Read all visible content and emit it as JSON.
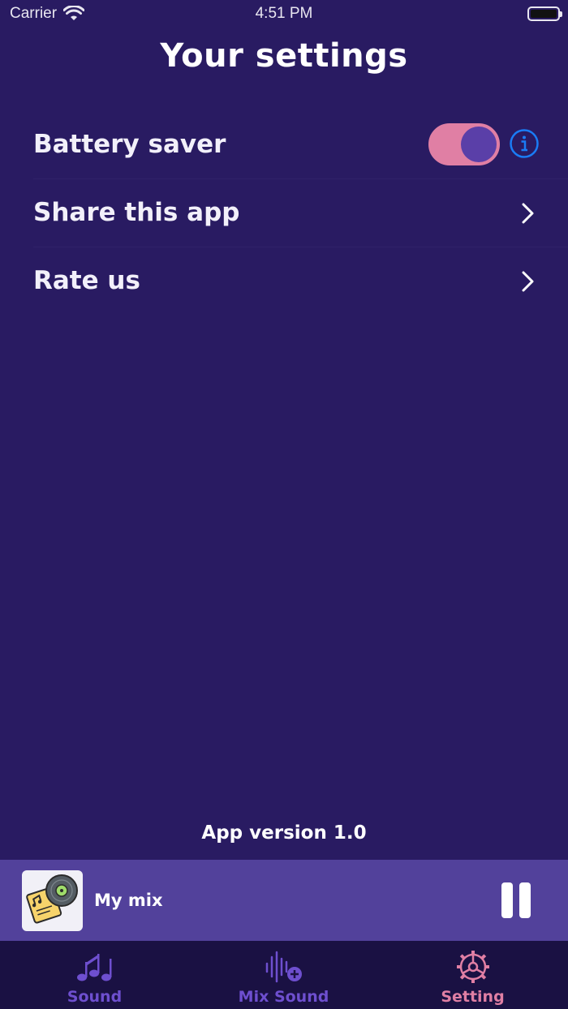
{
  "status_bar": {
    "carrier": "Carrier",
    "time": "4:51 PM"
  },
  "page": {
    "title": "Your settings"
  },
  "settings": {
    "battery_saver": {
      "label": "Battery saver",
      "enabled": true
    },
    "share": {
      "label": "Share this app"
    },
    "rate": {
      "label": "Rate us"
    }
  },
  "footer": {
    "version": "App version 1.0"
  },
  "player": {
    "track_title": "My mix",
    "state": "playing"
  },
  "tabs": [
    {
      "label": "Sound",
      "icon": "music-notes-icon",
      "active": false
    },
    {
      "label": "Mix Sound",
      "icon": "waveform-add-icon",
      "active": false
    },
    {
      "label": "Setting",
      "icon": "gear-icon",
      "active": true
    }
  ],
  "colors": {
    "background": "#291b62",
    "player_bg": "#52419b",
    "tab_bar_bg": "#1a1143",
    "accent_pink": "#e07fa4",
    "accent_purple": "#6e4fcf",
    "info_blue": "#1a7cf5"
  }
}
